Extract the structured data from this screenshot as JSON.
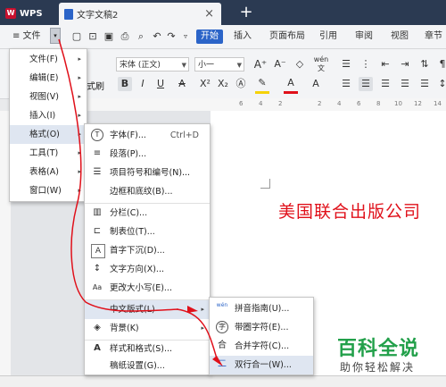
{
  "titlebar": {
    "app_tab": "WPS",
    "doc_tab": "文字文稿2",
    "close_glyph": "×",
    "new_tab_glyph": "+"
  },
  "menubar": {
    "file_button": "≡ 文件",
    "start": "开始",
    "items": [
      "插入",
      "页面布局",
      "引用",
      "审阅",
      "视图",
      "章节"
    ]
  },
  "toolbar": {
    "format_painter": "式刷",
    "font_name": "宋体 (正文)",
    "font_size": "小一",
    "pinyin": "wén",
    "ruler_numbers": [
      "6",
      "4",
      "2",
      "2",
      "4",
      "6",
      "8",
      "10",
      "12",
      "14"
    ]
  },
  "document": {
    "text": "美国联合出版公司"
  },
  "file_menu": {
    "items": [
      {
        "label": "文件(F)",
        "sub": true
      },
      {
        "label": "编辑(E)",
        "sub": true
      },
      {
        "label": "视图(V)",
        "sub": true
      },
      {
        "label": "插入(I)",
        "sub": true
      },
      {
        "label": "格式(O)",
        "sub": true
      },
      {
        "label": "工具(T)",
        "sub": true
      },
      {
        "label": "表格(A)",
        "sub": true
      },
      {
        "label": "窗口(W)",
        "sub": true
      }
    ]
  },
  "format_menu": {
    "items": [
      {
        "label": "字体(F)...",
        "shortcut": "Ctrl+D",
        "icon": "font-icon",
        "glyph": "T"
      },
      {
        "label": "段落(P)...",
        "icon": "paragraph-icon",
        "glyph": "≡"
      },
      {
        "label": "项目符号和编号(N)...",
        "icon": "bullets-icon",
        "glyph": "☰"
      },
      {
        "label": "边框和底纹(B)...",
        "icon": "",
        "glyph": ""
      },
      {
        "label": "分栏(C)...",
        "icon": "columns-icon",
        "glyph": "▥"
      },
      {
        "label": "制表位(T)...",
        "icon": "tab-stop-icon",
        "glyph": "⊏"
      },
      {
        "label": "首字下沉(D)...",
        "icon": "drop-cap-icon",
        "glyph": "A"
      },
      {
        "label": "文字方向(X)...",
        "icon": "text-direction-icon",
        "glyph": "↕"
      },
      {
        "label": "更改大小写(E)...",
        "icon": "change-case-icon",
        "glyph": "Aa"
      },
      {
        "label": "中文版式(L)",
        "sub": true,
        "icon": "",
        "glyph": ""
      },
      {
        "label": "背景(K)",
        "sub": true,
        "icon": "background-icon",
        "glyph": "◈"
      },
      {
        "label": "样式和格式(S)...",
        "icon": "styles-icon",
        "glyph": "A"
      },
      {
        "label": "稿纸设置(G)...",
        "icon": "",
        "glyph": ""
      }
    ]
  },
  "chinese_layout_menu": {
    "items": [
      {
        "label": "拼音指南(U)...",
        "icon": "pinyin-guide-icon",
        "glyph": "wén"
      },
      {
        "label": "带圈字符(E)...",
        "icon": "enclosed-char-icon",
        "glyph": "字"
      },
      {
        "label": "合并字符(C)...",
        "icon": "combine-chars-icon",
        "glyph": "合"
      },
      {
        "label": "双行合一(W)...",
        "icon": "two-lines-icon",
        "glyph": "二"
      }
    ]
  },
  "watermark": {
    "title": "百科全说",
    "subtitle": "助你轻松解决"
  },
  "colors": {
    "accent": "#2b64c8",
    "annotation": "#e0101a",
    "watermark": "#22a04a"
  }
}
